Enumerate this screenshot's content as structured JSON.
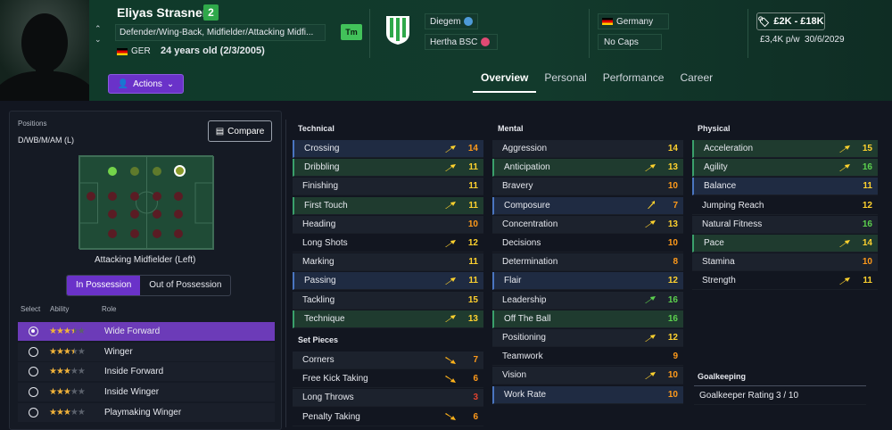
{
  "player": {
    "name": "Eliyas Strasner",
    "squad_number": "2",
    "positions_text": "Defender/Wing-Back, Midfielder/Attacking Midfi...",
    "tm_badge": "Tm",
    "nationality_code": "GER",
    "age_text": "24 years old (2/3/2005)"
  },
  "header": {
    "actions_label": "Actions",
    "club_parent": "Diegem",
    "club_current": "Hertha BSC",
    "country": "Germany",
    "caps": "No Caps",
    "value": "£2K - £18K",
    "wage_text": "£3,4K p/w",
    "contract_end": "30/6/2029"
  },
  "tabs": [
    {
      "label": "Overview",
      "active": true
    },
    {
      "label": "Personal",
      "active": false
    },
    {
      "label": "Performance",
      "active": false
    },
    {
      "label": "Career",
      "active": false
    }
  ],
  "positions_panel": {
    "label": "Positions",
    "value": "D/WB/M/AM (L)",
    "compare_label": "Compare",
    "role_title": "Attacking Midfielder (Left)",
    "toggle_on": "In Possession",
    "toggle_off": "Out of Possession",
    "col_select": "Select",
    "col_ability": "Ability",
    "col_role": "Role",
    "roles": [
      {
        "name": "Wide Forward",
        "stars": 3.5,
        "selected": true
      },
      {
        "name": "Winger",
        "stars": 3.5,
        "selected": false
      },
      {
        "name": "Inside Forward",
        "stars": 3,
        "selected": false
      },
      {
        "name": "Inside Winger",
        "stars": 3,
        "selected": false
      },
      {
        "name": "Playmaking Winger",
        "stars": 3,
        "selected": false
      }
    ]
  },
  "sections": {
    "technical": "Technical",
    "set_pieces": "Set Pieces",
    "mental": "Mental",
    "physical": "Physical",
    "goalkeeping": "Goalkeeping"
  },
  "technical": [
    {
      "name": "Crossing",
      "value": "14",
      "color": "orange",
      "arrow": "up",
      "hl": "blue"
    },
    {
      "name": "Dribbling",
      "value": "11",
      "color": "yellow",
      "arrow": "up",
      "hl": "green"
    },
    {
      "name": "Finishing",
      "value": "11",
      "color": "yellow",
      "arrow": "",
      "hl": ""
    },
    {
      "name": "First Touch",
      "value": "11",
      "color": "yellow",
      "arrow": "up",
      "hl": "green"
    },
    {
      "name": "Heading",
      "value": "10",
      "color": "orange",
      "arrow": "",
      "hl": ""
    },
    {
      "name": "Long Shots",
      "value": "12",
      "color": "yellow",
      "arrow": "up",
      "hl": ""
    },
    {
      "name": "Marking",
      "value": "11",
      "color": "yellow",
      "arrow": "",
      "hl": ""
    },
    {
      "name": "Passing",
      "value": "11",
      "color": "yellow",
      "arrow": "up",
      "hl": "blue"
    },
    {
      "name": "Tackling",
      "value": "15",
      "color": "yellow",
      "arrow": "",
      "hl": ""
    },
    {
      "name": "Technique",
      "value": "13",
      "color": "yellow",
      "arrow": "up",
      "hl": "green"
    }
  ],
  "set_pieces": [
    {
      "name": "Corners",
      "value": "7",
      "color": "orange",
      "arrow": "down",
      "hl": ""
    },
    {
      "name": "Free Kick Taking",
      "value": "6",
      "color": "orange",
      "arrow": "down",
      "hl": ""
    },
    {
      "name": "Long Throws",
      "value": "3",
      "color": "red",
      "arrow": "",
      "hl": ""
    },
    {
      "name": "Penalty Taking",
      "value": "6",
      "color": "orange",
      "arrow": "down",
      "hl": ""
    }
  ],
  "mental": [
    {
      "name": "Aggression",
      "value": "14",
      "color": "yellow",
      "arrow": "",
      "hl": ""
    },
    {
      "name": "Anticipation",
      "value": "13",
      "color": "yellow",
      "arrow": "up",
      "hl": "green"
    },
    {
      "name": "Bravery",
      "value": "10",
      "color": "orange",
      "arrow": "",
      "hl": ""
    },
    {
      "name": "Composure",
      "value": "7",
      "color": "orange",
      "arrow": "upsmall",
      "hl": "blue"
    },
    {
      "name": "Concentration",
      "value": "13",
      "color": "yellow",
      "arrow": "up",
      "hl": ""
    },
    {
      "name": "Decisions",
      "value": "10",
      "color": "orange",
      "arrow": "",
      "hl": ""
    },
    {
      "name": "Determination",
      "value": "8",
      "color": "orange",
      "arrow": "",
      "hl": ""
    },
    {
      "name": "Flair",
      "value": "12",
      "color": "yellow",
      "arrow": "",
      "hl": "blue"
    },
    {
      "name": "Leadership",
      "value": "16",
      "color": "green",
      "arrow": "upgreen",
      "hl": ""
    },
    {
      "name": "Off The Ball",
      "value": "16",
      "color": "green",
      "arrow": "",
      "hl": "green"
    },
    {
      "name": "Positioning",
      "value": "12",
      "color": "yellow",
      "arrow": "up",
      "hl": ""
    },
    {
      "name": "Teamwork",
      "value": "9",
      "color": "orange",
      "arrow": "",
      "hl": ""
    },
    {
      "name": "Vision",
      "value": "10",
      "color": "orange",
      "arrow": "up",
      "hl": ""
    },
    {
      "name": "Work Rate",
      "value": "10",
      "color": "orange",
      "arrow": "",
      "hl": "blue"
    }
  ],
  "physical": [
    {
      "name": "Acceleration",
      "value": "15",
      "color": "yellow",
      "arrow": "up",
      "hl": "green"
    },
    {
      "name": "Agility",
      "value": "16",
      "color": "green",
      "arrow": "up",
      "hl": "green"
    },
    {
      "name": "Balance",
      "value": "11",
      "color": "yellow",
      "arrow": "",
      "hl": "blue"
    },
    {
      "name": "Jumping Reach",
      "value": "12",
      "color": "yellow",
      "arrow": "",
      "hl": ""
    },
    {
      "name": "Natural Fitness",
      "value": "16",
      "color": "green",
      "arrow": "",
      "hl": ""
    },
    {
      "name": "Pace",
      "value": "14",
      "color": "yellow",
      "arrow": "up",
      "hl": "green"
    },
    {
      "name": "Stamina",
      "value": "10",
      "color": "orange",
      "arrow": "",
      "hl": ""
    },
    {
      "name": "Strength",
      "value": "11",
      "color": "yellow",
      "arrow": "up",
      "hl": ""
    }
  ],
  "goalkeeping": {
    "rating_label": "Goalkeeper Rating",
    "rating_value": "3 / 10"
  },
  "colors": {
    "accent": "#6a32c9",
    "orange": "#ff9a1a",
    "yellow": "#ffd22e",
    "green": "#5cd14e",
    "red": "#e2432f"
  }
}
